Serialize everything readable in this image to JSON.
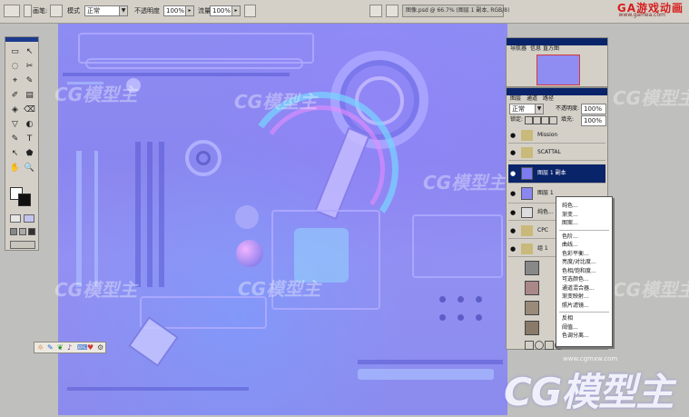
{
  "options_bar": {
    "mode_label": "模式",
    "mode_value": "正常",
    "opacity_label": "不透明度",
    "opacity_value": "100%",
    "flow_value": "100%",
    "doc_tab": "图像.psd @ 66.7% (图层 1 副本, RGB/8)"
  },
  "brand": {
    "logo": "GA游戏动画",
    "url": "www.gamea.com"
  },
  "watermarks": [
    "CG模型主",
    "CG模型主",
    "CG模型主",
    "CG模型主",
    "CG模型主",
    "CG模型主",
    "CG模型主"
  ],
  "watermark_url": "www.cgmxw.com",
  "toolbox": {
    "tools": [
      "▭",
      "↖",
      "◌",
      "✂",
      "⌖",
      "✎",
      "✐",
      "▤",
      "◈",
      "⌫",
      "▽",
      "◐",
      "✎",
      "T",
      "↖",
      "⬟",
      "✋",
      "🔍"
    ]
  },
  "navigator_panel": {
    "tabs": [
      "导航器",
      "信息",
      "直方图"
    ]
  },
  "layers_panel": {
    "tabs": [
      "图层",
      "通道",
      "路径"
    ],
    "blend_mode": "正常",
    "opacity_label": "不透明度:",
    "opacity_value": "100%",
    "lock_label": "锁定:",
    "fill_label": "填充:",
    "fill_value": "100%",
    "layers": [
      {
        "name": "Mission",
        "type": "group",
        "selected": false
      },
      {
        "name": "SCATTAL",
        "type": "group",
        "selected": false
      },
      {
        "name": "图层 1 副本",
        "type": "layer",
        "selected": true
      },
      {
        "name": "图层 1",
        "type": "layer",
        "selected": false
      },
      {
        "name": "纯色...",
        "type": "layer",
        "selected": false
      },
      {
        "name": "CPC",
        "type": "group",
        "selected": false
      },
      {
        "name": "组 1",
        "type": "group",
        "selected": false
      }
    ]
  },
  "context_menu": {
    "items": [
      "纯色...",
      "渐变...",
      "图案...",
      "色阶...",
      "曲线...",
      "色彩平衡...",
      "亮度/对比度...",
      "色相/饱和度...",
      "可选颜色...",
      "通道混合器...",
      "渐变映射...",
      "照片滤镜...",
      "反相",
      "阈值...",
      "色调分离..."
    ],
    "separators_after": [
      2,
      11
    ]
  },
  "colors": {
    "chrome": "#d4d0c8",
    "title_bar": "#0a246a",
    "canvas_base": "#8d8cf3",
    "brand_red": "#d61e1e"
  }
}
